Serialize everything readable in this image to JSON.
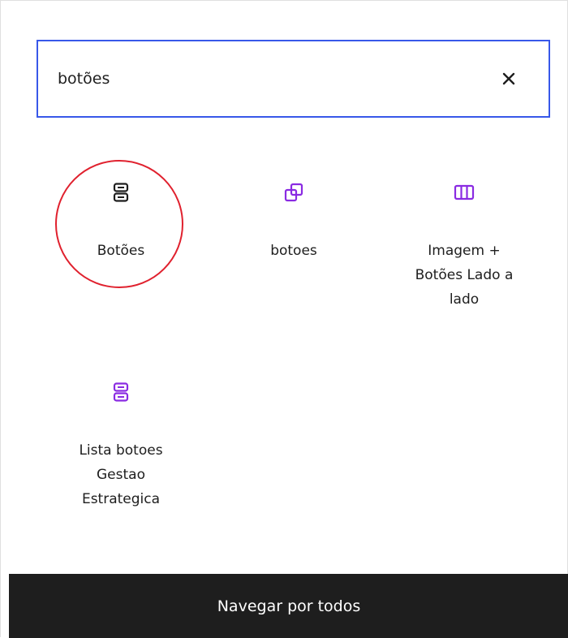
{
  "search": {
    "value": "botões",
    "clear_icon": "close-icon"
  },
  "results": [
    {
      "label": "Botões",
      "icon": "buttons-icon",
      "icon_color": "#1e1e1e",
      "highlighted": true
    },
    {
      "label": "botoes",
      "icon": "reusable-block-icon",
      "icon_color": "#8a2be2"
    },
    {
      "label": "Imagem + Botões Lado a lado",
      "icon": "columns-icon",
      "icon_color": "#8a2be2"
    },
    {
      "label": "Lista botoes Gestao Estrategica",
      "icon": "buttons-icon",
      "icon_color": "#8a2be2"
    }
  ],
  "footer": {
    "label": "Navegar por todos"
  },
  "colors": {
    "accent": "#3858e9",
    "highlight": "#e0212e",
    "footer_bg": "#1e1e1e"
  }
}
